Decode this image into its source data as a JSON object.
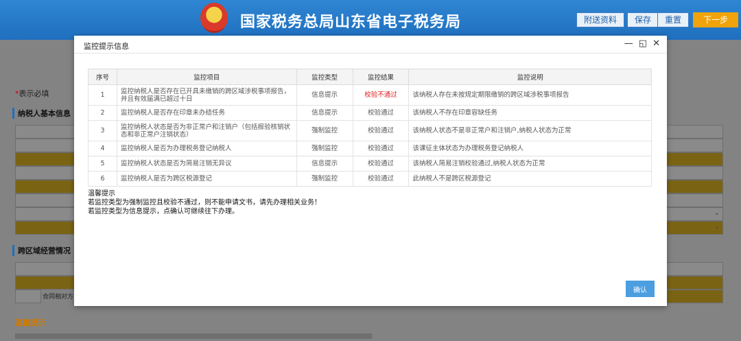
{
  "header": {
    "brand": "国家税务总局山东省电子税务局",
    "buttons": {
      "attach": "附送资料",
      "save": "保存",
      "reset": "重置",
      "next": "下一步"
    }
  },
  "page": {
    "required_star": "*",
    "required_note": "表示必填",
    "section_basic": "纳税人基本信息",
    "section_cross": "跨区域经营情况",
    "contract_label": "合同相对方",
    "warm_title": "温馨提示"
  },
  "modal": {
    "title": "监控提示信息",
    "tools": {
      "minimize": "—",
      "maximize": "◱",
      "close": "✕"
    },
    "table": {
      "headers": [
        "序号",
        "监控项目",
        "监控类型",
        "监控结果",
        "监控说明"
      ],
      "rows": [
        {
          "no": "1",
          "item": "监控纳税人是否存在已开具未缴销的跨区域涉税事项报告，并且有效届满已超过十日",
          "type": "信息提示",
          "result": "校验不通过",
          "desc": "该纳税人存在未按规定期限缴销的跨区域涉税事项报告"
        },
        {
          "no": "2",
          "item": "监控纳税人是否存在印章未办结任务",
          "type": "信息提示",
          "result": "校验通过",
          "desc": "该纳税人不存在印章容缺任务"
        },
        {
          "no": "3",
          "item": "监控纳税人状态是否为非正常户和注销户（包括报验核销状态和非正常户注销状态）",
          "type": "强制监控",
          "result": "校验通过",
          "desc": "该纳税人状态不是非正常户和注销户,纳税人状态为正常"
        },
        {
          "no": "4",
          "item": "监控纳税人是否为办理税务登记纳税人",
          "type": "强制监控",
          "result": "校验通过",
          "desc": "该课征主体状态为办理税务登记纳税人"
        },
        {
          "no": "5",
          "item": "监控纳税人状态是否为简易注销无异议",
          "type": "信息提示",
          "result": "校验通过",
          "desc": "该纳税人简易注销校验通过,纳税人状态为正常"
        },
        {
          "no": "6",
          "item": "监控纳税人是否为跨区税源登记",
          "type": "强制监控",
          "result": "校验通过",
          "desc": "此纳税人不是跨区税源登记"
        }
      ]
    },
    "tips": {
      "title": "温馨提示",
      "line1": "若监控类型为强制监控且校验不通过，则不能申请文书，请先办理相关业务！",
      "line2": "若监控类型为信息提示，点确认可继续往下办理。"
    },
    "confirm": "确认"
  },
  "colors": {
    "fail": "#e21b1b",
    "primary": "#4b9ee0",
    "next": "#f0a30a"
  }
}
